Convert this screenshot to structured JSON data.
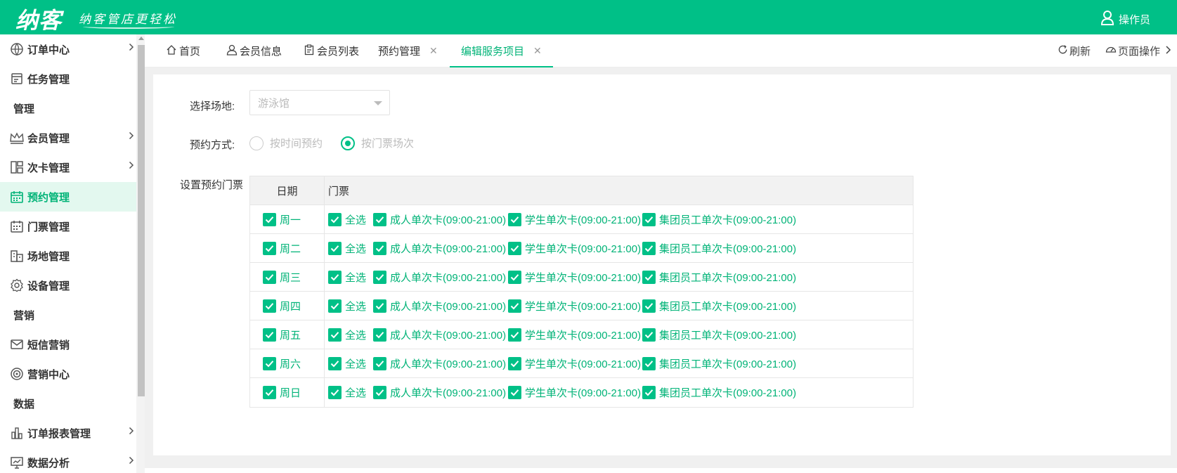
{
  "header": {
    "logo": "纳客",
    "slogan": "纳客管店更轻松",
    "user_label": "操作员"
  },
  "sidebar": {
    "items": [
      {
        "type": "item",
        "label": "订单中心",
        "icon": "globe-icon",
        "arrow": true
      },
      {
        "type": "item",
        "label": "任务管理",
        "icon": "task-icon",
        "arrow": false
      },
      {
        "type": "group",
        "label": "管理"
      },
      {
        "type": "item",
        "label": "会员管理",
        "icon": "crown-icon",
        "arrow": true
      },
      {
        "type": "item",
        "label": "次卡管理",
        "icon": "card-layout-icon",
        "arrow": true
      },
      {
        "type": "item",
        "label": "预约管理",
        "icon": "calendar-icon",
        "arrow": false,
        "active": true
      },
      {
        "type": "item",
        "label": "门票管理",
        "icon": "ticket-calendar-icon",
        "arrow": false
      },
      {
        "type": "item",
        "label": "场地管理",
        "icon": "building-icon",
        "arrow": false
      },
      {
        "type": "item",
        "label": "设备管理",
        "icon": "gear-icon",
        "arrow": false
      },
      {
        "type": "group",
        "label": "营销"
      },
      {
        "type": "item",
        "label": "短信营销",
        "icon": "mail-icon",
        "arrow": false
      },
      {
        "type": "item",
        "label": "营销中心",
        "icon": "target-icon",
        "arrow": false
      },
      {
        "type": "group",
        "label": "数据"
      },
      {
        "type": "item",
        "label": "订单报表管理",
        "icon": "bar-chart-icon",
        "arrow": true
      },
      {
        "type": "item",
        "label": "数据分析",
        "icon": "monitor-chart-icon",
        "arrow": true
      }
    ]
  },
  "tabs": [
    {
      "label": "首页",
      "icon": "home-icon",
      "closable": false,
      "active": false
    },
    {
      "label": "会员信息",
      "icon": "user-icon",
      "closable": false,
      "active": false
    },
    {
      "label": "会员列表",
      "icon": "clipboard-icon",
      "closable": false,
      "active": false
    },
    {
      "label": "预约管理",
      "icon": "",
      "closable": true,
      "active": false
    },
    {
      "label": "编辑服务项目",
      "icon": "",
      "closable": true,
      "active": true
    }
  ],
  "toolbar": {
    "refresh_label": "刷新",
    "page_ops_label": "页面操作"
  },
  "form": {
    "venue_label": "选择场地:",
    "venue_placeholder": "游泳馆",
    "mode_label": "预约方式:",
    "mode_options": [
      {
        "label": "按时间预约",
        "selected": false
      },
      {
        "label": "按门票场次",
        "selected": true
      }
    ],
    "tickets_label": "设置预约门票"
  },
  "ticket_table": {
    "headers": {
      "day": "日期",
      "tickets": "门票"
    },
    "select_all_label": "全选",
    "ticket_types": [
      "成人单次卡(09:00-21:00)",
      "学生单次卡(09:00-21:00)",
      "集团员工单次卡(09:00-21:00)"
    ],
    "days": [
      "周一",
      "周二",
      "周三",
      "周四",
      "周五",
      "周六",
      "周日"
    ]
  },
  "colors": {
    "brand": "#00c087",
    "active_text": "#00b377",
    "active_bg": "#e3f8ef"
  }
}
